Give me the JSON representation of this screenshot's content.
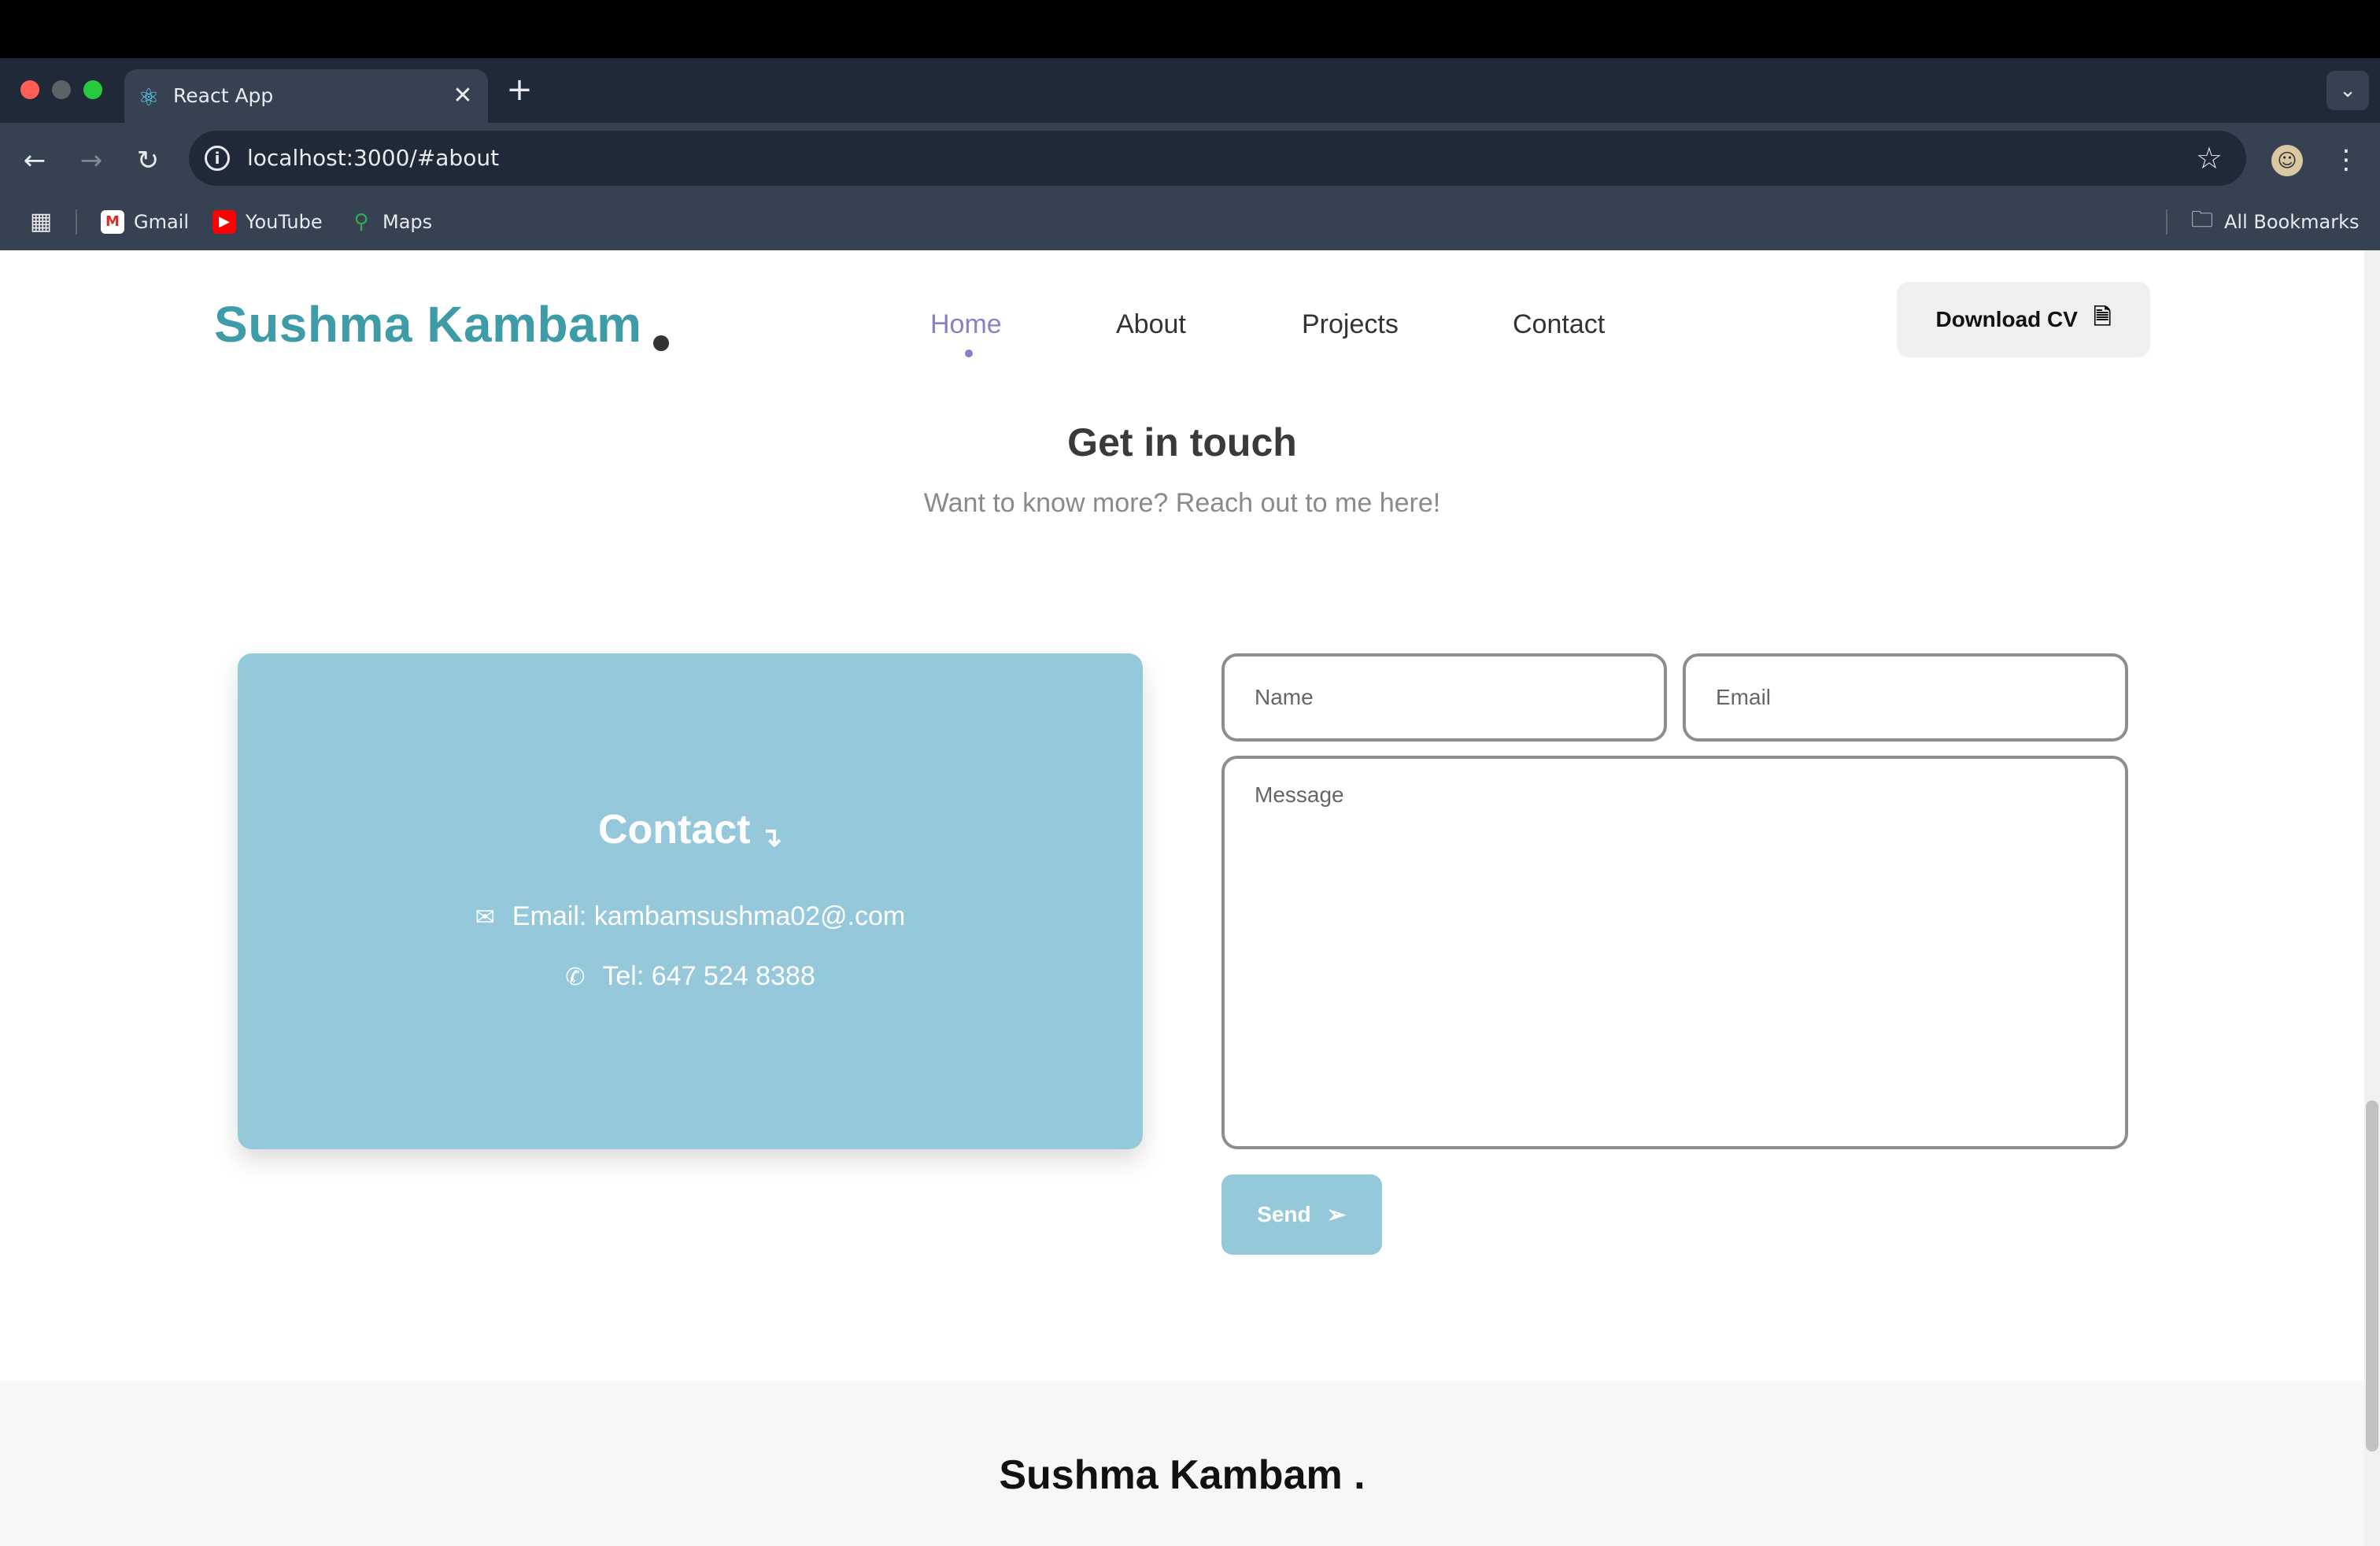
{
  "browser": {
    "tab_title": "React App",
    "tab_icon": "react-logo-icon",
    "url_prefix": "localhost",
    "url": "localhost:3000/#about",
    "bookmarks": [
      {
        "label": "Gmail",
        "icon": "gmail-icon",
        "glyph": "M"
      },
      {
        "label": "YouTube",
        "icon": "youtube-icon",
        "glyph": "▶"
      },
      {
        "label": "Maps",
        "icon": "maps-icon",
        "glyph": "⚲"
      }
    ],
    "all_bookmarks": "All Bookmarks"
  },
  "site": {
    "logo": "Sushma Kambam",
    "nav": [
      "Home",
      "About",
      "Projects",
      "Contact"
    ],
    "active_nav": "Home",
    "download_cv": "Download CV",
    "accent_color": "#3d9ca8",
    "active_color": "#8a7fc8"
  },
  "contact_section": {
    "heading": "Get in touch",
    "subheading": "Want to know more? Reach out to me here!",
    "card": {
      "title": "Contact",
      "email": "Email: kambamsushma02@.com",
      "tel": "Tel: 647 524 8388",
      "color": "#95c8da"
    },
    "form": {
      "name_placeholder": "Name",
      "email_placeholder": "Email",
      "message_placeholder": "Message",
      "send_label": "Send"
    }
  },
  "footer": {
    "title": "Sushma Kambam ."
  }
}
